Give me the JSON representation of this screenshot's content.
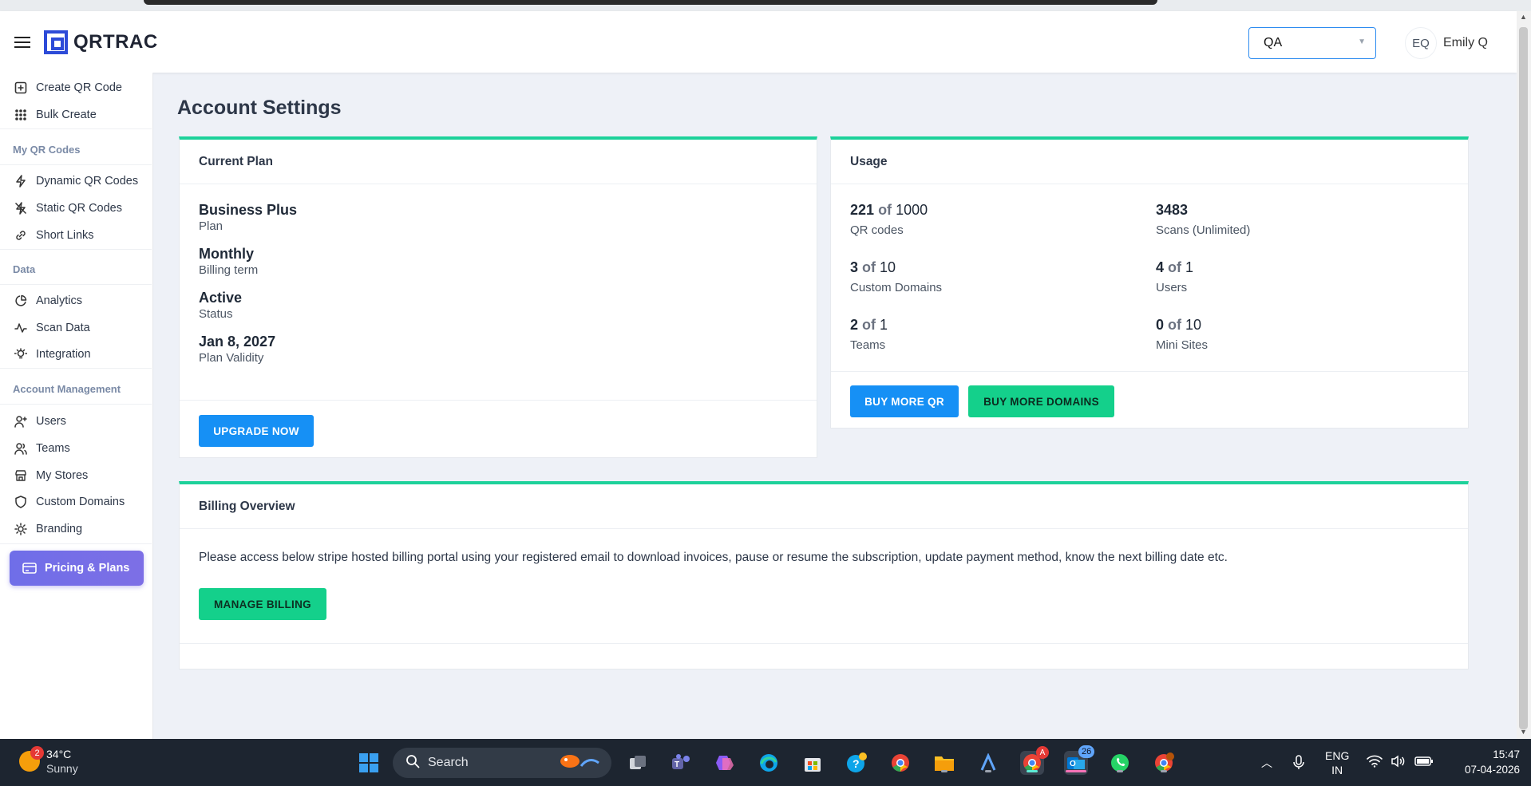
{
  "app": {
    "brand": "QRTRAC",
    "team_select": "QA",
    "user_initials": "EQ",
    "user_name": "Emily Q"
  },
  "sidebar": {
    "items": [
      {
        "label": "Create QR Code",
        "icon": "plus-square-icon"
      },
      {
        "label": "Bulk Create",
        "icon": "grid-icon"
      },
      {
        "heading": "My QR Codes"
      },
      {
        "label": "Dynamic QR Codes",
        "icon": "lightning-icon"
      },
      {
        "label": "Static QR Codes",
        "icon": "lightning-off-icon"
      },
      {
        "label": "Short Links",
        "icon": "link-icon"
      },
      {
        "heading": "Data"
      },
      {
        "label": "Analytics",
        "icon": "pie-chart-icon"
      },
      {
        "label": "Scan Data",
        "icon": "activity-icon"
      },
      {
        "label": "Integration",
        "icon": "bulb-icon"
      },
      {
        "heading": "Account Management"
      },
      {
        "label": "Users",
        "icon": "user-plus-icon"
      },
      {
        "label": "Teams",
        "icon": "users-icon"
      },
      {
        "label": "My Stores",
        "icon": "store-icon"
      },
      {
        "label": "Custom Domains",
        "icon": "shield-icon"
      },
      {
        "label": "Branding",
        "icon": "sun-icon"
      }
    ],
    "pricing_label": "Pricing & Plans"
  },
  "page": {
    "title": "Account Settings"
  },
  "current_plan": {
    "header": "Current Plan",
    "entries": [
      {
        "value": "Business Plus",
        "key": "Plan"
      },
      {
        "value": "Monthly",
        "key": "Billing term"
      },
      {
        "value": "Active",
        "key": "Status"
      },
      {
        "value": "Jan 8, 2027",
        "key": "Plan Validity"
      }
    ],
    "upgrade_label": "UPGRADE NOW"
  },
  "usage": {
    "header": "Usage",
    "of_word": "of",
    "items": [
      {
        "used": "221",
        "total": "1000",
        "label": "QR codes"
      },
      {
        "used": "3483",
        "total": "",
        "label": "Scans (Unlimited)"
      },
      {
        "used": "3",
        "total": "10",
        "label": "Custom Domains"
      },
      {
        "used": "4",
        "total": "1",
        "label": "Users"
      },
      {
        "used": "2",
        "total": "1",
        "label": "Teams"
      },
      {
        "used": "0",
        "total": "10",
        "label": "Mini Sites"
      }
    ],
    "buy_qr_label": "BUY MORE QR",
    "buy_domains_label": "BUY MORE DOMAINS"
  },
  "billing": {
    "header": "Billing Overview",
    "text": "Please access below stripe hosted billing portal using your registered email to download invoices, pause or resume the subscription, update payment method, know the next billing date etc.",
    "manage_label": "MANAGE BILLING"
  },
  "taskbar": {
    "weather_badge": "2",
    "temperature": "34°C",
    "condition": "Sunny",
    "search_placeholder": "Search",
    "chrome_badge": "A",
    "mail_badge": "26",
    "lang_top": "ENG",
    "lang_bottom": "IN",
    "time": "15:47",
    "date": "07-04-2026"
  },
  "colors": {
    "accent_green": "#1dd19a",
    "primary_blue": "#1690f5",
    "pricing_purple": "#7370e8",
    "brand_blue": "#2d4bd8"
  }
}
